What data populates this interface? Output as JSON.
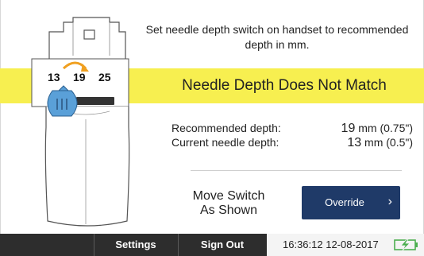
{
  "instruction": "Set needle depth switch on handset to recommended depth in mm.",
  "alert_title": "Needle Depth Does Not Match",
  "handset": {
    "depth_options": [
      "13",
      "19",
      "25"
    ],
    "current_position": "13",
    "recommended_position": "19"
  },
  "depth": {
    "recommended_label": "Recommended depth:",
    "recommended_value": "19",
    "recommended_unit": " mm (0.75\")",
    "current_label": "Current needle depth:",
    "current_value": "13",
    "current_unit": " mm (0.5\")"
  },
  "move_message_line1": "Move Switch",
  "move_message_line2": "As Shown",
  "override_label": "Override",
  "bottom_bar": {
    "settings_label": "Settings",
    "signout_label": "Sign Out",
    "clock": "16:36:12  12-08-2017"
  },
  "icons": {
    "arrow": "curved-arrow-icon",
    "chevron": "chevron-right-icon",
    "battery": "battery-charging-icon"
  },
  "colors": {
    "alert_band": "#f7ef50",
    "button": "#1f3a68",
    "switch_blue": "#5aa0d8",
    "arrow_orange": "#f0a020",
    "battery_green": "#4caf50"
  }
}
